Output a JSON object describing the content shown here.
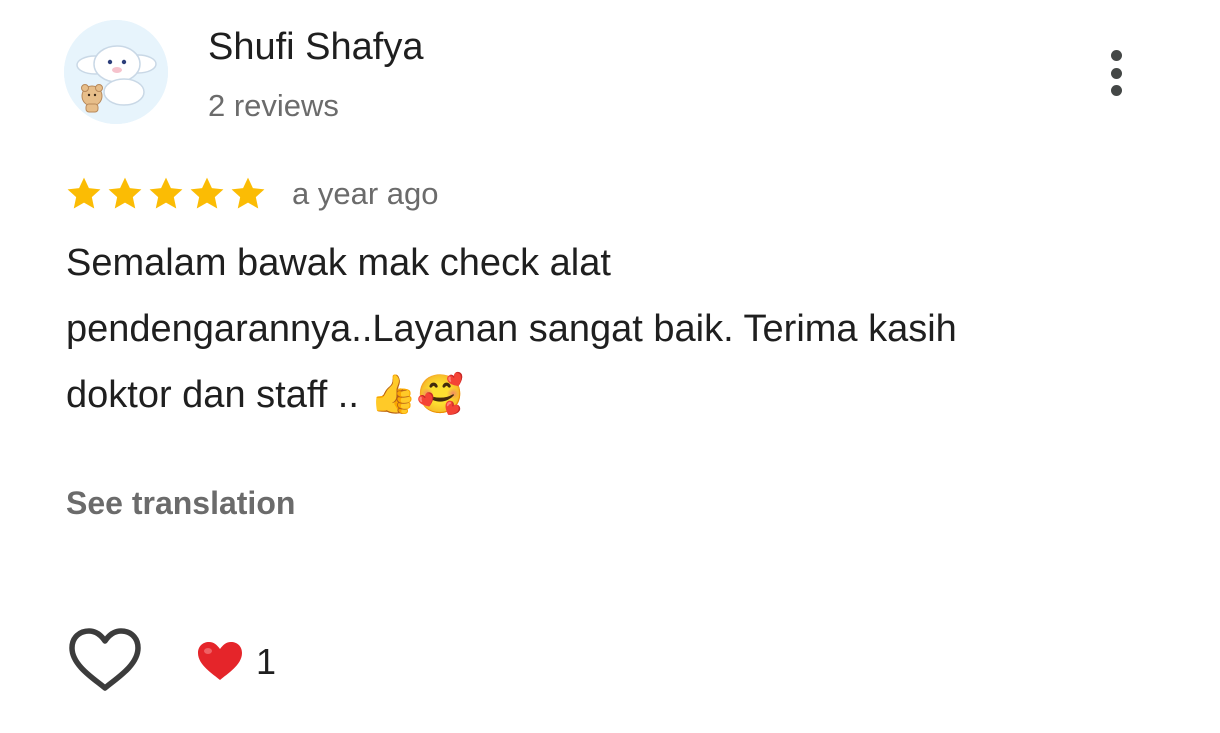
{
  "review": {
    "author": {
      "name": "Shufi Shafya",
      "review_count": "2 reviews",
      "avatar_icon": "cartoon-puppy-avatar"
    },
    "more_options_icon": "three-dots-vertical-icon",
    "rating": {
      "stars": 5,
      "max_stars": 5,
      "star_color": "#fbbc04"
    },
    "date": "a year ago",
    "text_lines": [
      "Semalam bawak mak check alat",
      "pendengarannya..Layanan sangat baik. Terima kasih",
      "doktor dan staff .. 👍🥰"
    ],
    "see_translation_label": "See translation",
    "like_icon": "heart-outline-icon",
    "reaction": {
      "icon": "red-heart-emoji",
      "emoji": "❤️",
      "count": "1"
    }
  }
}
